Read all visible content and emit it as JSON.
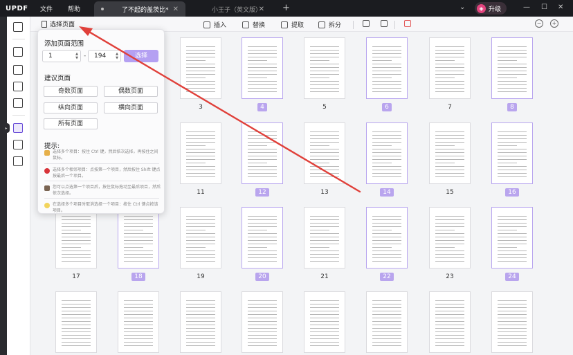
{
  "app": {
    "logo": "UPDF",
    "menu": [
      "文件",
      "帮助"
    ]
  },
  "tabs": [
    {
      "label": "了不起的盖茨比*",
      "active": true
    },
    {
      "label": "小王子（英文版）",
      "active": false
    }
  ],
  "upgrade_label": "升级",
  "toolbar": {
    "insert": "插入",
    "replace": "替换",
    "extract": "提取",
    "split": "拆分"
  },
  "select_pages_label": "选择页面",
  "popup": {
    "title": "添加页面范围",
    "range_from": "1",
    "range_to": "194",
    "select_button": "选择",
    "suggested_title": "建议页面",
    "buttons": [
      "奇数页面",
      "偶数页面",
      "纵向页面",
      "横向页面",
      "所有页面"
    ],
    "tips_title": "提示:",
    "tips": [
      "选择多个项目：按住 Ctrl 键，然后依次选择，再按住之间鼠标。",
      "选择多个相邻项目：点按第一个项目，然后按住 Shift 键点按最后一个项目。",
      "您可以点选第一个项目后，按住鼠标拖动至最后项目，然后依次选择。",
      "在选择多个项目时取消选择一个项目：按住 Ctrl 键点按该项目。"
    ]
  },
  "pages": [
    {
      "n": "3",
      "sel": false
    },
    {
      "n": "4",
      "sel": true
    },
    {
      "n": "5",
      "sel": false
    },
    {
      "n": "6",
      "sel": true
    },
    {
      "n": "7",
      "sel": false
    },
    {
      "n": "8",
      "sel": true
    },
    {
      "n": "11",
      "sel": false
    },
    {
      "n": "12",
      "sel": true
    },
    {
      "n": "13",
      "sel": false
    },
    {
      "n": "14",
      "sel": true
    },
    {
      "n": "15",
      "sel": false
    },
    {
      "n": "16",
      "sel": true
    },
    {
      "n": "17",
      "sel": false
    },
    {
      "n": "18",
      "sel": true
    },
    {
      "n": "19",
      "sel": false
    },
    {
      "n": "20",
      "sel": true
    },
    {
      "n": "21",
      "sel": false
    },
    {
      "n": "22",
      "sel": true
    },
    {
      "n": "23",
      "sel": false
    },
    {
      "n": "24",
      "sel": true
    }
  ],
  "colors": {
    "accent": "#b4a0f2",
    "arrow": "#e0403a",
    "titlebar": "#1b1c20"
  }
}
